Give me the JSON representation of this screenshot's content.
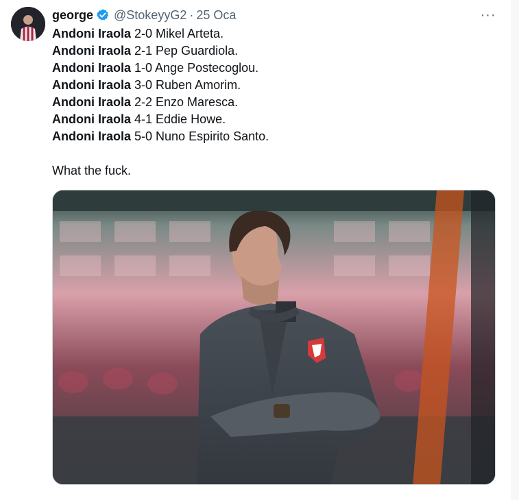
{
  "author": {
    "name": "george",
    "handle": "@StokeyyG2",
    "separator": "·",
    "date": "25 Oca"
  },
  "icons": {
    "verified": "verified-badge-icon",
    "more": "more-options-icon"
  },
  "colors": {
    "verified": "#1d9bf0",
    "secondary_text": "#536471",
    "primary_text": "#0f1419"
  },
  "tweet": {
    "results": [
      {
        "manager": "Andoni Iraola",
        "result": " 2-0 Mikel Arteta."
      },
      {
        "manager": "Andoni Iraola",
        "result": " 2-1 Pep Guardiola."
      },
      {
        "manager": "Andoni Iraola",
        "result": " 1-0 Ange Postecoglou."
      },
      {
        "manager": "Andoni Iraola",
        "result": " 3-0 Ruben Amorim."
      },
      {
        "manager": "Andoni Iraola",
        "result": " 2-2 Enzo Maresca."
      },
      {
        "manager": "Andoni Iraola",
        "result": " 4-1 Eddie Howe."
      },
      {
        "manager": "Andoni Iraola",
        "result": " 5-0 Nuno Espirito Santo."
      }
    ],
    "closing": "What the fuck."
  },
  "more_label": "···"
}
